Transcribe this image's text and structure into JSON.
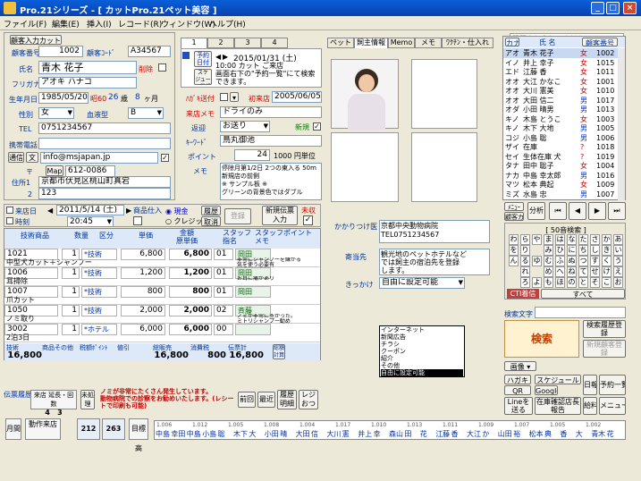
{
  "window": {
    "title": "Pro.21シリーズ - [ カットPro.21ペット美容 ]"
  },
  "menu": [
    "ファイル(F)",
    "編集(E)",
    "挿入(I)",
    "レコード(R)",
    "ウィンドウ(W)",
    "ヘルプ(H)"
  ],
  "help_placeholder": "質問を入力してください",
  "customer": {
    "input_btn": "顧客入力カット",
    "num_label": "顧客番号",
    "num": "1002",
    "code_label": "顧客ｺｰﾄﾞ",
    "code": "A34567",
    "name_label": "氏名",
    "name": "青木 花子",
    "del_label": "削除",
    "kana_label": "フリガナ",
    "kana": "アオキ ハナコ",
    "birth_label": "生年月日",
    "birth": "1985/05/20",
    "era": "昭60",
    "age": "26",
    "age_unit": "歳",
    "month": "8",
    "month_unit": "ヶ月",
    "sex_label": "性別",
    "sex": "女",
    "blood_label": "血液型",
    "blood": "B",
    "tel_label": "TEL",
    "tel": "0751234567",
    "mobile_label": "携帯電話",
    "mobile": "",
    "mail_label1": "通信",
    "mail_label2": "文",
    "mail": "info@msjapan.jp",
    "zip_label": "〒",
    "map_btn": "Map",
    "zip": "612-0086",
    "addr1_label": "住所1",
    "addr1": "京都市伏見区桃山町真宕",
    "addr2_label": "2",
    "addr2": "123"
  },
  "mid": {
    "tabs": [
      "1",
      "2",
      "3",
      "4"
    ],
    "reserve_btn": "予約日付",
    "reserve_date": "2015/01/31 (土)",
    "reserve_note": "10:00 カット ご来店\n画面右下の\"予約一覧\"にて検索できます。",
    "reserve_btn2": "スケジュール登録",
    "hagaki_label": "ﾊｶﾞｷ送付",
    "first_label": "初来店",
    "first_date": "2005/06/05",
    "memo_label": "来店メモ",
    "memo": "ドライのみ",
    "return_label": "返迎",
    "return": "お送り",
    "new_label": "新規",
    "keyword_label": "ｷｰﾜｰﾄﾞ",
    "keyword": "鳥丸御池",
    "point_label": "ポイント",
    "point": "24",
    "point_unit": "1000 円単位",
    "memo2_label": "メモ",
    "memo2": "停除月第1/2日 2つの東入る 50m新規店の前側\n※ サンプル板 ※\nグリーンの背景色ではダブル"
  },
  "visit": {
    "label": "来店日",
    "time_label": "時刻",
    "date": "2011/5/14 (土)",
    "time": "20:45",
    "prod_label": "商品仕入",
    "cash": "現金",
    "credit": "クレジット",
    "history": "履歴",
    "cancel": "取消",
    "register": "登録",
    "new_slip": "新規伝票入力",
    "unpaid": "未収"
  },
  "lines": {
    "headers": [
      "技術商品",
      "数量",
      "区分",
      "単価",
      "金額\n原単価",
      "スタッフ\n指名",
      "スタッフポイント\nメモ"
    ],
    "rows": [
      {
        "code": "1021",
        "name": "中型犬カット＋シャンプー",
        "qty": "1",
        "kind": "*技術",
        "price": "6,800",
        "amount": "6,800",
        "sub": "01",
        "staff": "岡田",
        "memo": "非常にシャンプーを嫌がる\n気を使う必要有"
      },
      {
        "code": "1006",
        "name": "耳掃除",
        "qty": "1",
        "kind": "*技術",
        "price": "1,200",
        "amount": "1,200",
        "sub": "01",
        "staff": "岡田",
        "memo": "お耳に痛があり"
      },
      {
        "code": "1007",
        "name": "爪カット",
        "qty": "1",
        "kind": "*技術",
        "price": "800",
        "amount": "800",
        "sub": "01",
        "staff": "岡田",
        "memo": ""
      },
      {
        "code": "1050",
        "name": "ノミ取り",
        "qty": "1",
        "kind": "*技術",
        "price": "2,000",
        "amount": "2,000",
        "sub": "02",
        "staff": "斉藤",
        "memo": "ノミが非常に多かった。\nミトリシャンプー勧め"
      },
      {
        "code": "3002",
        "name": "2泊3日",
        "qty": "1",
        "kind": "*ホテル",
        "price": "6,000",
        "amount": "6,000",
        "sub": "00",
        "staff": "",
        "memo": ""
      }
    ],
    "total_labels": [
      "技術",
      "商品その他",
      "税額ﾎﾟｲﾝﾄ",
      "値引",
      "総販売",
      "消費税",
      "伝票計"
    ],
    "totals": [
      "16,800",
      "",
      "",
      "",
      "16,800",
      "800",
      "16,800"
    ],
    "calc_btn": "総額計算"
  },
  "notes": {
    "history_label": "伝票履歴",
    "count_label": "来店 延長・回数",
    "count1": "4",
    "count2": "3",
    "unpaid_label": "未処理",
    "warn": "ノミが非常にたくさん発生しています。\n動物病院での診察をお勧めいたします。(レシートで印刷も可能)",
    "prev": "前回",
    "recent": "最近",
    "hist_detail": "履歴明細",
    "receipt": "レジおつり"
  },
  "pet": {
    "tabs": [
      "ペット",
      "飼主情報",
      "Memo",
      "メモ",
      "ﾜｸﾁﾝ・仕入れ"
    ],
    "vet_label": "かかりつけ医",
    "vet": "京都中央動物病院\nTEL0751234567",
    "mail_label": "寄当先",
    "mail": "観光地のペットホテルなど\nでは飼主の宿泊先を登録\nします。",
    "trigger_label": "きっかけ",
    "trigger": "自由に設定可能",
    "trigger_options": [
      "インターネット",
      "新聞広告",
      "チラシ",
      "クーポン",
      "紹介",
      "その他",
      "自由に設定可能"
    ]
  },
  "right": {
    "headers": [
      "カナ",
      "氏 名",
      "",
      "顧客番号"
    ],
    "rows": [
      [
        "アオ",
        "青木 花子",
        "女",
        "1002"
      ],
      [
        "イノ",
        "井上 幸子",
        "女",
        "1015"
      ],
      [
        "エド",
        "江藤 香",
        "女",
        "1011"
      ],
      [
        "オオ",
        "大江 かなこ",
        "女",
        "1001"
      ],
      [
        "オオ",
        "大川 憲美",
        "女",
        "1010"
      ],
      [
        "オオ",
        "大田 信二",
        "男",
        "1017"
      ],
      [
        "オダ",
        "小田 晴男",
        "男",
        "1013"
      ],
      [
        "キノ",
        "木島 とうこ",
        "女",
        "1003"
      ],
      [
        "キノ",
        "木下 大地",
        "男",
        "1005"
      ],
      [
        "コジ",
        "小島 聡",
        "男",
        "1006"
      ],
      [
        "ザイ",
        "在庫",
        "?",
        "1018"
      ],
      [
        "セイ",
        "生体在庫 犬",
        "?",
        "1019"
      ],
      [
        "タナ",
        "田中 聡子",
        "女",
        "1004"
      ],
      [
        "ナカ",
        "中島 幸太郎",
        "男",
        "1016"
      ],
      [
        "マツ",
        "松本 典起",
        "女",
        "1009"
      ],
      [
        "ミズ",
        "水島 忠",
        "男",
        "1007"
      ]
    ],
    "mode": "ﾒﾆｭｰ",
    "reg_card": "顧客カード",
    "analysis": "分析",
    "kana_title": "[ 50音検索 ]",
    "kana": [
      "わ",
      "ら",
      "や",
      "ま",
      "は",
      "な",
      "た",
      "さ",
      "か",
      "あ",
      "を",
      "り",
      "",
      "み",
      "ひ",
      "に",
      "ち",
      "し",
      "き",
      "い",
      "ん",
      "る",
      "ゆ",
      "む",
      "ふ",
      "ぬ",
      "つ",
      "す",
      "く",
      "う",
      "",
      "れ",
      "",
      "め",
      "へ",
      "ね",
      "て",
      "せ",
      "け",
      "え",
      "",
      "ろ",
      "よ",
      "も",
      "ほ",
      "の",
      "と",
      "そ",
      "こ",
      "お"
    ],
    "cti": "CTI着信",
    "all": "すべて",
    "search_label": "検索文字",
    "search_btn": "検索",
    "hist_reg": "検索履歴登録",
    "new_reg": "新規顧客登録",
    "image_btn": "画像",
    "hagaki": "ハガキ",
    "schedule": "スケジュール",
    "daily": "日報",
    "reserve_list": "予約一覧",
    "qr": "QR",
    "google": "Google",
    "line": "Lineを送る",
    "shop_memo": "在庫確認店長報告",
    "kyuuryou": "給料",
    "menu": "メニュー",
    "finish": "終了",
    "close": "締め"
  },
  "bottom": {
    "labels": [
      "月間",
      "動作来店",
      "目標高",
      "目標計"
    ],
    "vals": [
      "212",
      "263"
    ],
    "names": [
      "中島",
      "幸田",
      "中島",
      "小島",
      "聡",
      "木下",
      "大",
      "小田",
      "晴",
      "大田",
      "信",
      "大川",
      "憲",
      "井上",
      "幸",
      "森山",
      "田",
      "花",
      "江藤",
      "香",
      "大江",
      "か",
      "山田",
      "裕",
      "松本",
      "典",
      "香",
      "大",
      "青木",
      "花"
    ],
    "codes": [
      "1.006",
      "1.012",
      "1.005",
      "1.008",
      "1.004",
      "1.017",
      "1.010",
      "1.013",
      "1.011",
      "1.009",
      "1.007",
      "1.005",
      "1.002"
    ]
  }
}
